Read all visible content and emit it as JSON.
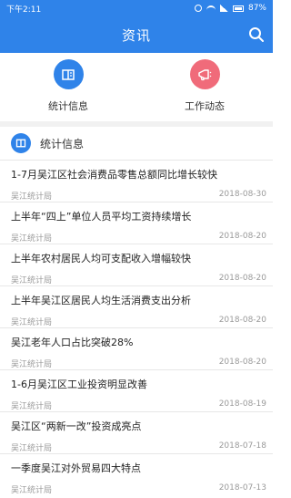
{
  "status_bar": {
    "time": "下午2:11",
    "battery": "87%"
  },
  "header": {
    "title": "资讯"
  },
  "shortcuts": [
    {
      "label": "统计信息",
      "icon": "book-icon",
      "color": "#2f83e9"
    },
    {
      "label": "工作动态",
      "icon": "megaphone-icon",
      "color": "#f06b7a"
    }
  ],
  "section": {
    "title": "统计信息",
    "icon": "book-icon"
  },
  "news": [
    {
      "headline": "1-7月吴江区社会消费品零售总额同比增长较快",
      "source": "吴江统计局",
      "date": "2018-08-30"
    },
    {
      "headline": "上半年“四上”单位人员平均工资持续增长",
      "source": "吴江统计局",
      "date": "2018-08-20"
    },
    {
      "headline": "上半年农村居民人均可支配收入增幅较快",
      "source": "吴江统计局",
      "date": "2018-08-20"
    },
    {
      "headline": "上半年吴江区居民人均生活消费支出分析",
      "source": "吴江统计局",
      "date": "2018-08-20"
    },
    {
      "headline": "吴江老年人口占比突破28%",
      "source": "吴江统计局",
      "date": "2018-08-20"
    },
    {
      "headline": "1-6月吴江区工业投资明显改善",
      "source": "吴江统计局",
      "date": "2018-08-19"
    },
    {
      "headline": "吴江区“两新一改”投资成亮点",
      "source": "吴江统计局",
      "date": "2018-07-18"
    },
    {
      "headline": "一季度吴江对外贸易四大特点",
      "source": "吴江统计局",
      "date": "2018-07-13"
    }
  ]
}
